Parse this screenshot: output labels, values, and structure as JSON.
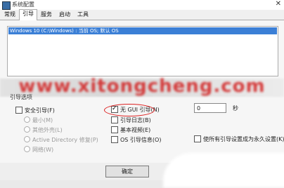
{
  "window": {
    "title": "系统配置",
    "close_glyph": "✕"
  },
  "tabs": [
    {
      "label": "常规"
    },
    {
      "label": "引导"
    },
    {
      "label": "服务"
    },
    {
      "label": "启动"
    },
    {
      "label": "工具"
    }
  ],
  "os_list": {
    "entries": [
      "Windows 10 (C:\\Windows) : 当前 OS; 默认 OS"
    ]
  },
  "watermark": "www.xitongcheng.com",
  "boot_options": {
    "legend": "引导选项",
    "safe_boot": {
      "label": "安全引导(F)",
      "checked": false
    },
    "radio_minimal": "最小(M)",
    "radio_alt_shell": "其他外壳(L)",
    "radio_ad_repair": "Active Directory 修复(P)",
    "radio_network": "网络(W)",
    "no_gui": {
      "label": "无 GUI 引导(N)",
      "checked": true
    },
    "boot_log": {
      "label": "引导日志(B)",
      "checked": false
    },
    "base_video": {
      "label": "基本视频(E)",
      "checked": false
    },
    "os_boot_info": {
      "label": "OS 引导信息(O)",
      "checked": false
    }
  },
  "timeout": {
    "value": "0",
    "unit": "秒"
  },
  "make_permanent": {
    "label": "使所有引导设置成为永久设置(K)",
    "checked": false
  },
  "footer": {
    "ok_label": "确定"
  },
  "colors": {
    "selected_row": "#3b7fd6",
    "highlight_circle": "#dd2222",
    "watermark": "#d21f1f"
  }
}
